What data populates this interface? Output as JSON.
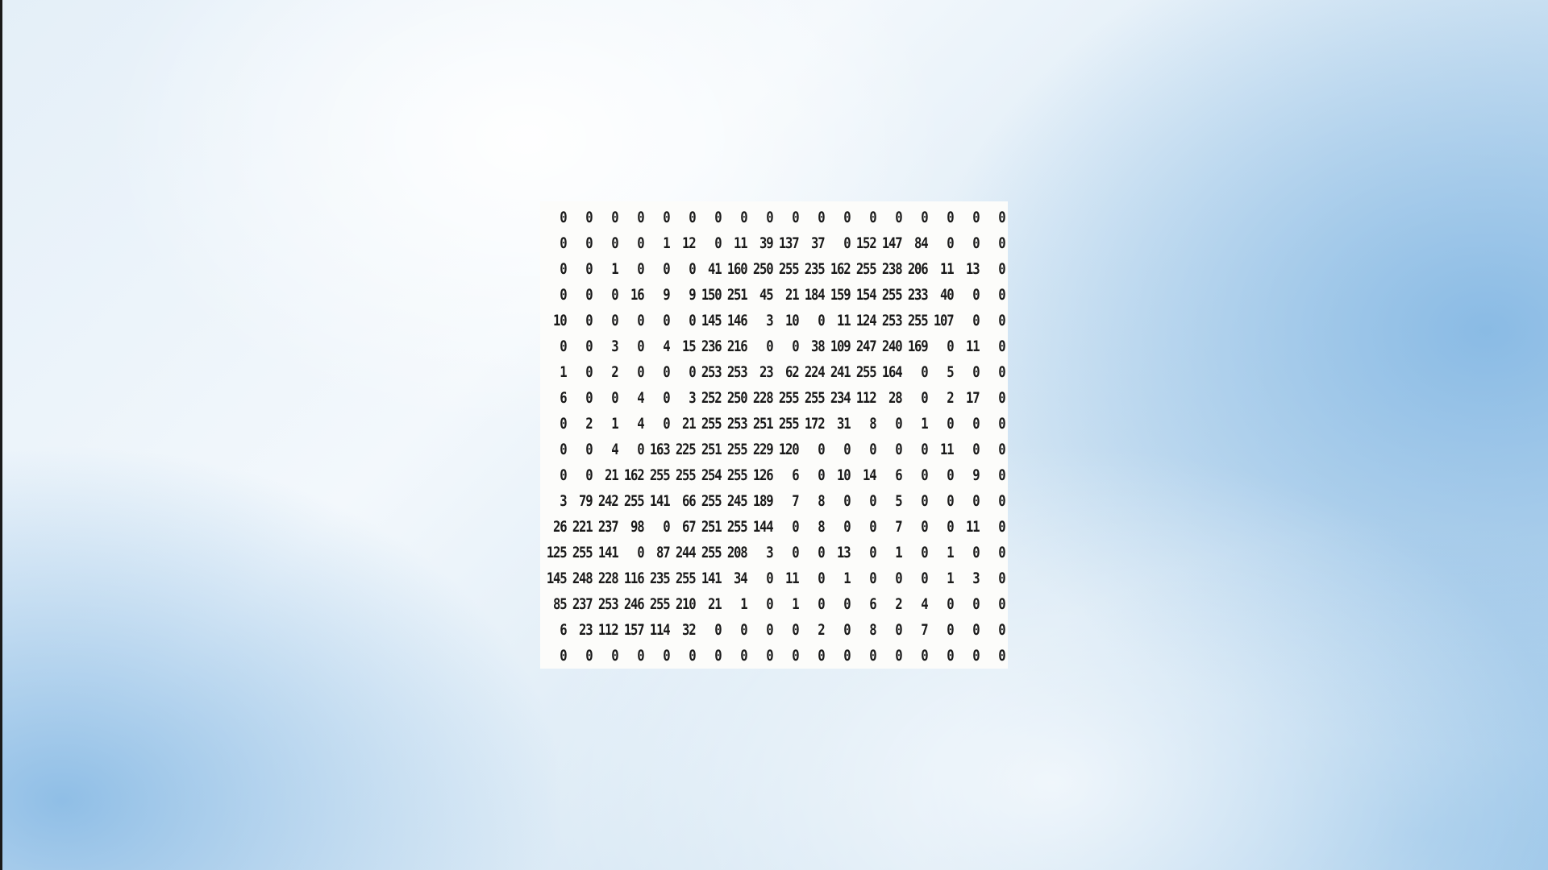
{
  "matrix": {
    "rows": [
      [
        "0",
        "0",
        "0",
        "0",
        "0",
        "0",
        "0",
        "0",
        "0",
        "0",
        "0",
        "0",
        "0",
        "0",
        "0",
        "0",
        "0",
        "0"
      ],
      [
        "0",
        "0",
        "0",
        "0",
        "1",
        "12",
        "0",
        "11",
        "39",
        "137",
        "37",
        "0",
        "152",
        "147",
        "84",
        "0",
        "0",
        "0"
      ],
      [
        "0",
        "0",
        "1",
        "0",
        "0",
        "0",
        "41",
        "160",
        "250",
        "255",
        "235",
        "162",
        "255",
        "238",
        "206",
        "11",
        "13",
        "0"
      ],
      [
        "0",
        "0",
        "0",
        "16",
        "9",
        "9",
        "150",
        "251",
        "45",
        "21",
        "184",
        "159",
        "154",
        "255",
        "233",
        "40",
        "0",
        "0"
      ],
      [
        "10",
        "0",
        "0",
        "0",
        "0",
        "0",
        "145",
        "146",
        "3",
        "10",
        "0",
        "11",
        "124",
        "253",
        "255",
        "107",
        "0",
        "0"
      ],
      [
        "0",
        "0",
        "3",
        "0",
        "4",
        "15",
        "236",
        "216",
        "0",
        "0",
        "38",
        "109",
        "247",
        "240",
        "169",
        "0",
        "11",
        "0"
      ],
      [
        "1",
        "0",
        "2",
        "0",
        "0",
        "0",
        "253",
        "253",
        "23",
        "62",
        "224",
        "241",
        "255",
        "164",
        "0",
        "5",
        "0",
        "0"
      ],
      [
        "6",
        "0",
        "0",
        "4",
        "0",
        "3",
        "252",
        "250",
        "228",
        "255",
        "255",
        "234",
        "112",
        "28",
        "0",
        "2",
        "17",
        "0"
      ],
      [
        "0",
        "2",
        "1",
        "4",
        "0",
        "21",
        "255",
        "253",
        "251",
        "255",
        "172",
        "31",
        "8",
        "0",
        "1",
        "0",
        "0",
        "0"
      ],
      [
        "0",
        "0",
        "4",
        "0",
        "163",
        "225",
        "251",
        "255",
        "229",
        "120",
        "0",
        "0",
        "0",
        "0",
        "0",
        "11",
        "0",
        "0"
      ],
      [
        "0",
        "0",
        "21",
        "162",
        "255",
        "255",
        "254",
        "255",
        "126",
        "6",
        "0",
        "10",
        "14",
        "6",
        "0",
        "0",
        "9",
        "0"
      ],
      [
        "3",
        "79",
        "242",
        "255",
        "141",
        "66",
        "255",
        "245",
        "189",
        "7",
        "8",
        "0",
        "0",
        "5",
        "0",
        "0",
        "0",
        "0"
      ],
      [
        "26",
        "221",
        "237",
        "98",
        "0",
        "67",
        "251",
        "255",
        "144",
        "0",
        "8",
        "0",
        "0",
        "7",
        "0",
        "0",
        "11",
        "0"
      ],
      [
        "125",
        "255",
        "141",
        "0",
        "87",
        "244",
        "255",
        "208",
        "3",
        "0",
        "0",
        "13",
        "0",
        "1",
        "0",
        "1",
        "0",
        "0"
      ],
      [
        "145",
        "248",
        "228",
        "116",
        "235",
        "255",
        "141",
        "34",
        "0",
        "11",
        "0",
        "1",
        "0",
        "0",
        "0",
        "1",
        "3",
        "0"
      ],
      [
        "85",
        "237",
        "253",
        "246",
        "255",
        "210",
        "21",
        "1",
        "0",
        "1",
        "0",
        "0",
        "6",
        "2",
        "4",
        "0",
        "0",
        "0"
      ],
      [
        "6",
        "23",
        "112",
        "157",
        "114",
        "32",
        "0",
        "0",
        "0",
        "0",
        "2",
        "0",
        "8",
        "0",
        "7",
        "0",
        "0",
        "0"
      ],
      [
        "0",
        "0",
        "0",
        "0",
        "0",
        "0",
        "0",
        "0",
        "0",
        "0",
        "0",
        "0",
        "0",
        "0",
        "0",
        "0",
        "0",
        "0"
      ]
    ]
  }
}
